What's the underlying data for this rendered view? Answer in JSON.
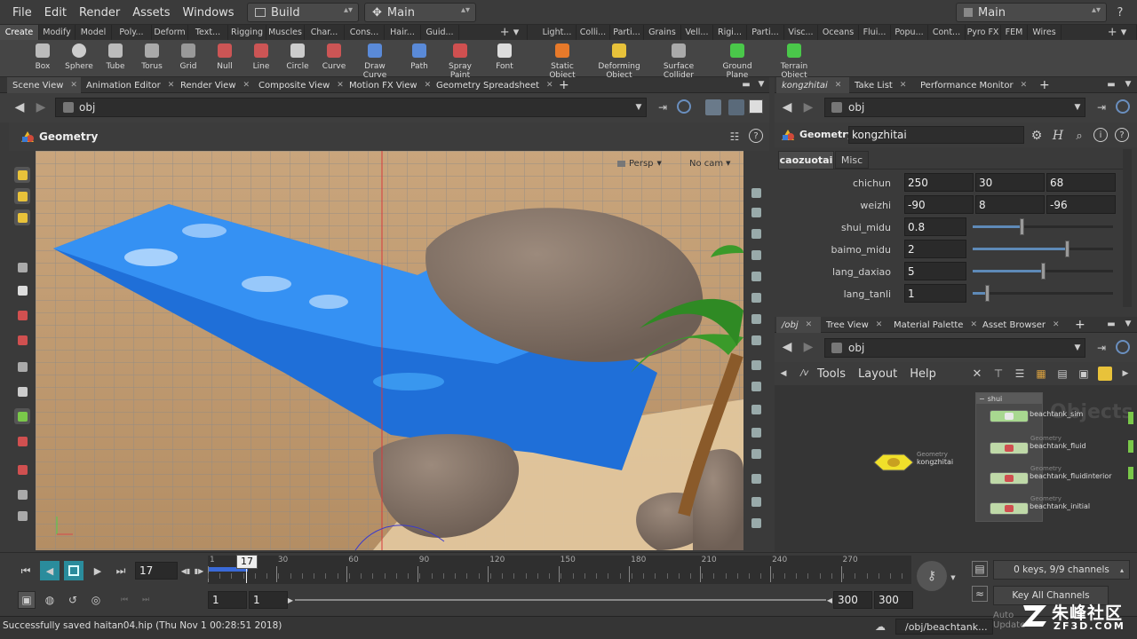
{
  "menubar": {
    "items": [
      "File",
      "Edit",
      "Render",
      "Assets",
      "Windows",
      "Help"
    ],
    "desktop": "Build",
    "pane_link": "Main",
    "right_desktop": "Main"
  },
  "shelf_tabs_left": [
    "Create",
    "Modify",
    "Model",
    "Poly...",
    "Deform",
    "Text...",
    "Rigging",
    "Muscles",
    "Char...",
    "Cons...",
    "Hair...",
    "Guid..."
  ],
  "shelf_tabs_right": [
    "Light...",
    "Colli...",
    "Parti...",
    "Grains",
    "Vell...",
    "Rigi...",
    "Parti...",
    "Visc...",
    "Oceans",
    "Flui...",
    "Popu...",
    "Cont...",
    "Pyro FX",
    "FEM",
    "Wires"
  ],
  "tools_left": [
    "Box",
    "Sphere",
    "Tube",
    "Torus",
    "Grid",
    "Null",
    "Line",
    "Circle",
    "Curve",
    "Draw Curve",
    "Path",
    "Spray Paint",
    "Font"
  ],
  "tools_right": [
    {
      "label1": "Static Object",
      "label2": ""
    },
    {
      "label1": "Deforming",
      "label2": "Object"
    },
    {
      "label1": "Surface",
      "label2": "Collider"
    },
    {
      "label1": "Ground Plane",
      "label2": ""
    },
    {
      "label1": "Terrain Object",
      "label2": ""
    }
  ],
  "left_pane_tabs": [
    "Scene View",
    "Animation Editor",
    "Render View",
    "Composite View",
    "Motion FX View",
    "Geometry Spreadsheet"
  ],
  "left_path": "obj",
  "viewport": {
    "title": "Geometry",
    "persp": "Persp",
    "cam": "No cam"
  },
  "param_pane": {
    "tabs": [
      "kongzhitai",
      "Take List",
      "Performance Monitor"
    ],
    "path": "obj",
    "node_type": "Geometry",
    "node_name": "kongzhitai",
    "folders": [
      "caozuotai",
      "Misc"
    ],
    "params": [
      {
        "label": "chichun",
        "values": [
          "250",
          "30",
          "68"
        ]
      },
      {
        "label": "weizhi",
        "values": [
          "-90",
          "8",
          "-96"
        ]
      },
      {
        "label": "shui_midu",
        "value": "0.8",
        "slider": 0.35
      },
      {
        "label": "baimo_midu",
        "value": "2",
        "slider": 0.67
      },
      {
        "label": "lang_daxiao",
        "value": "5",
        "slider": 0.5
      },
      {
        "label": "lang_tanli",
        "value": "1",
        "slider": 0.1
      }
    ]
  },
  "network_pane": {
    "tabs": [
      "/obj",
      "Tree View",
      "Material Palette",
      "Asset Browser"
    ],
    "path": "obj",
    "menu": [
      "Tools",
      "Layout",
      "Help"
    ],
    "watermark": "Objects",
    "network_box": "shui",
    "nodes": [
      {
        "type": "",
        "name": "beachtank_sim"
      },
      {
        "type": "Geometry",
        "name": "beachtank_fluid"
      },
      {
        "type": "Geometry",
        "name": "beachtank_fluidinterior"
      },
      {
        "type": "Geometry",
        "name": "beachtank_initial"
      }
    ],
    "control_node": {
      "type": "Geometry",
      "name": "kongzhitai"
    }
  },
  "timeline": {
    "frame": "17",
    "cursor_label": "17",
    "ticks": [
      "1",
      "30",
      "60",
      "90",
      "120",
      "150",
      "180",
      "210",
      "240",
      "270"
    ],
    "start": "1",
    "start2": "1",
    "end": "300",
    "end2": "300",
    "keys_info": "0 keys, 9/9 channels",
    "key_all": "Key All Channels",
    "auto_update": "Auto Update"
  },
  "status": {
    "message": "Successfully saved haitan04.hip (Thu Nov  1 00:28:51 2018)",
    "path": "/obj/beachtank..."
  },
  "brand": {
    "logo_text": "朱峰社区",
    "logo_url": "ZF3D.COM"
  }
}
